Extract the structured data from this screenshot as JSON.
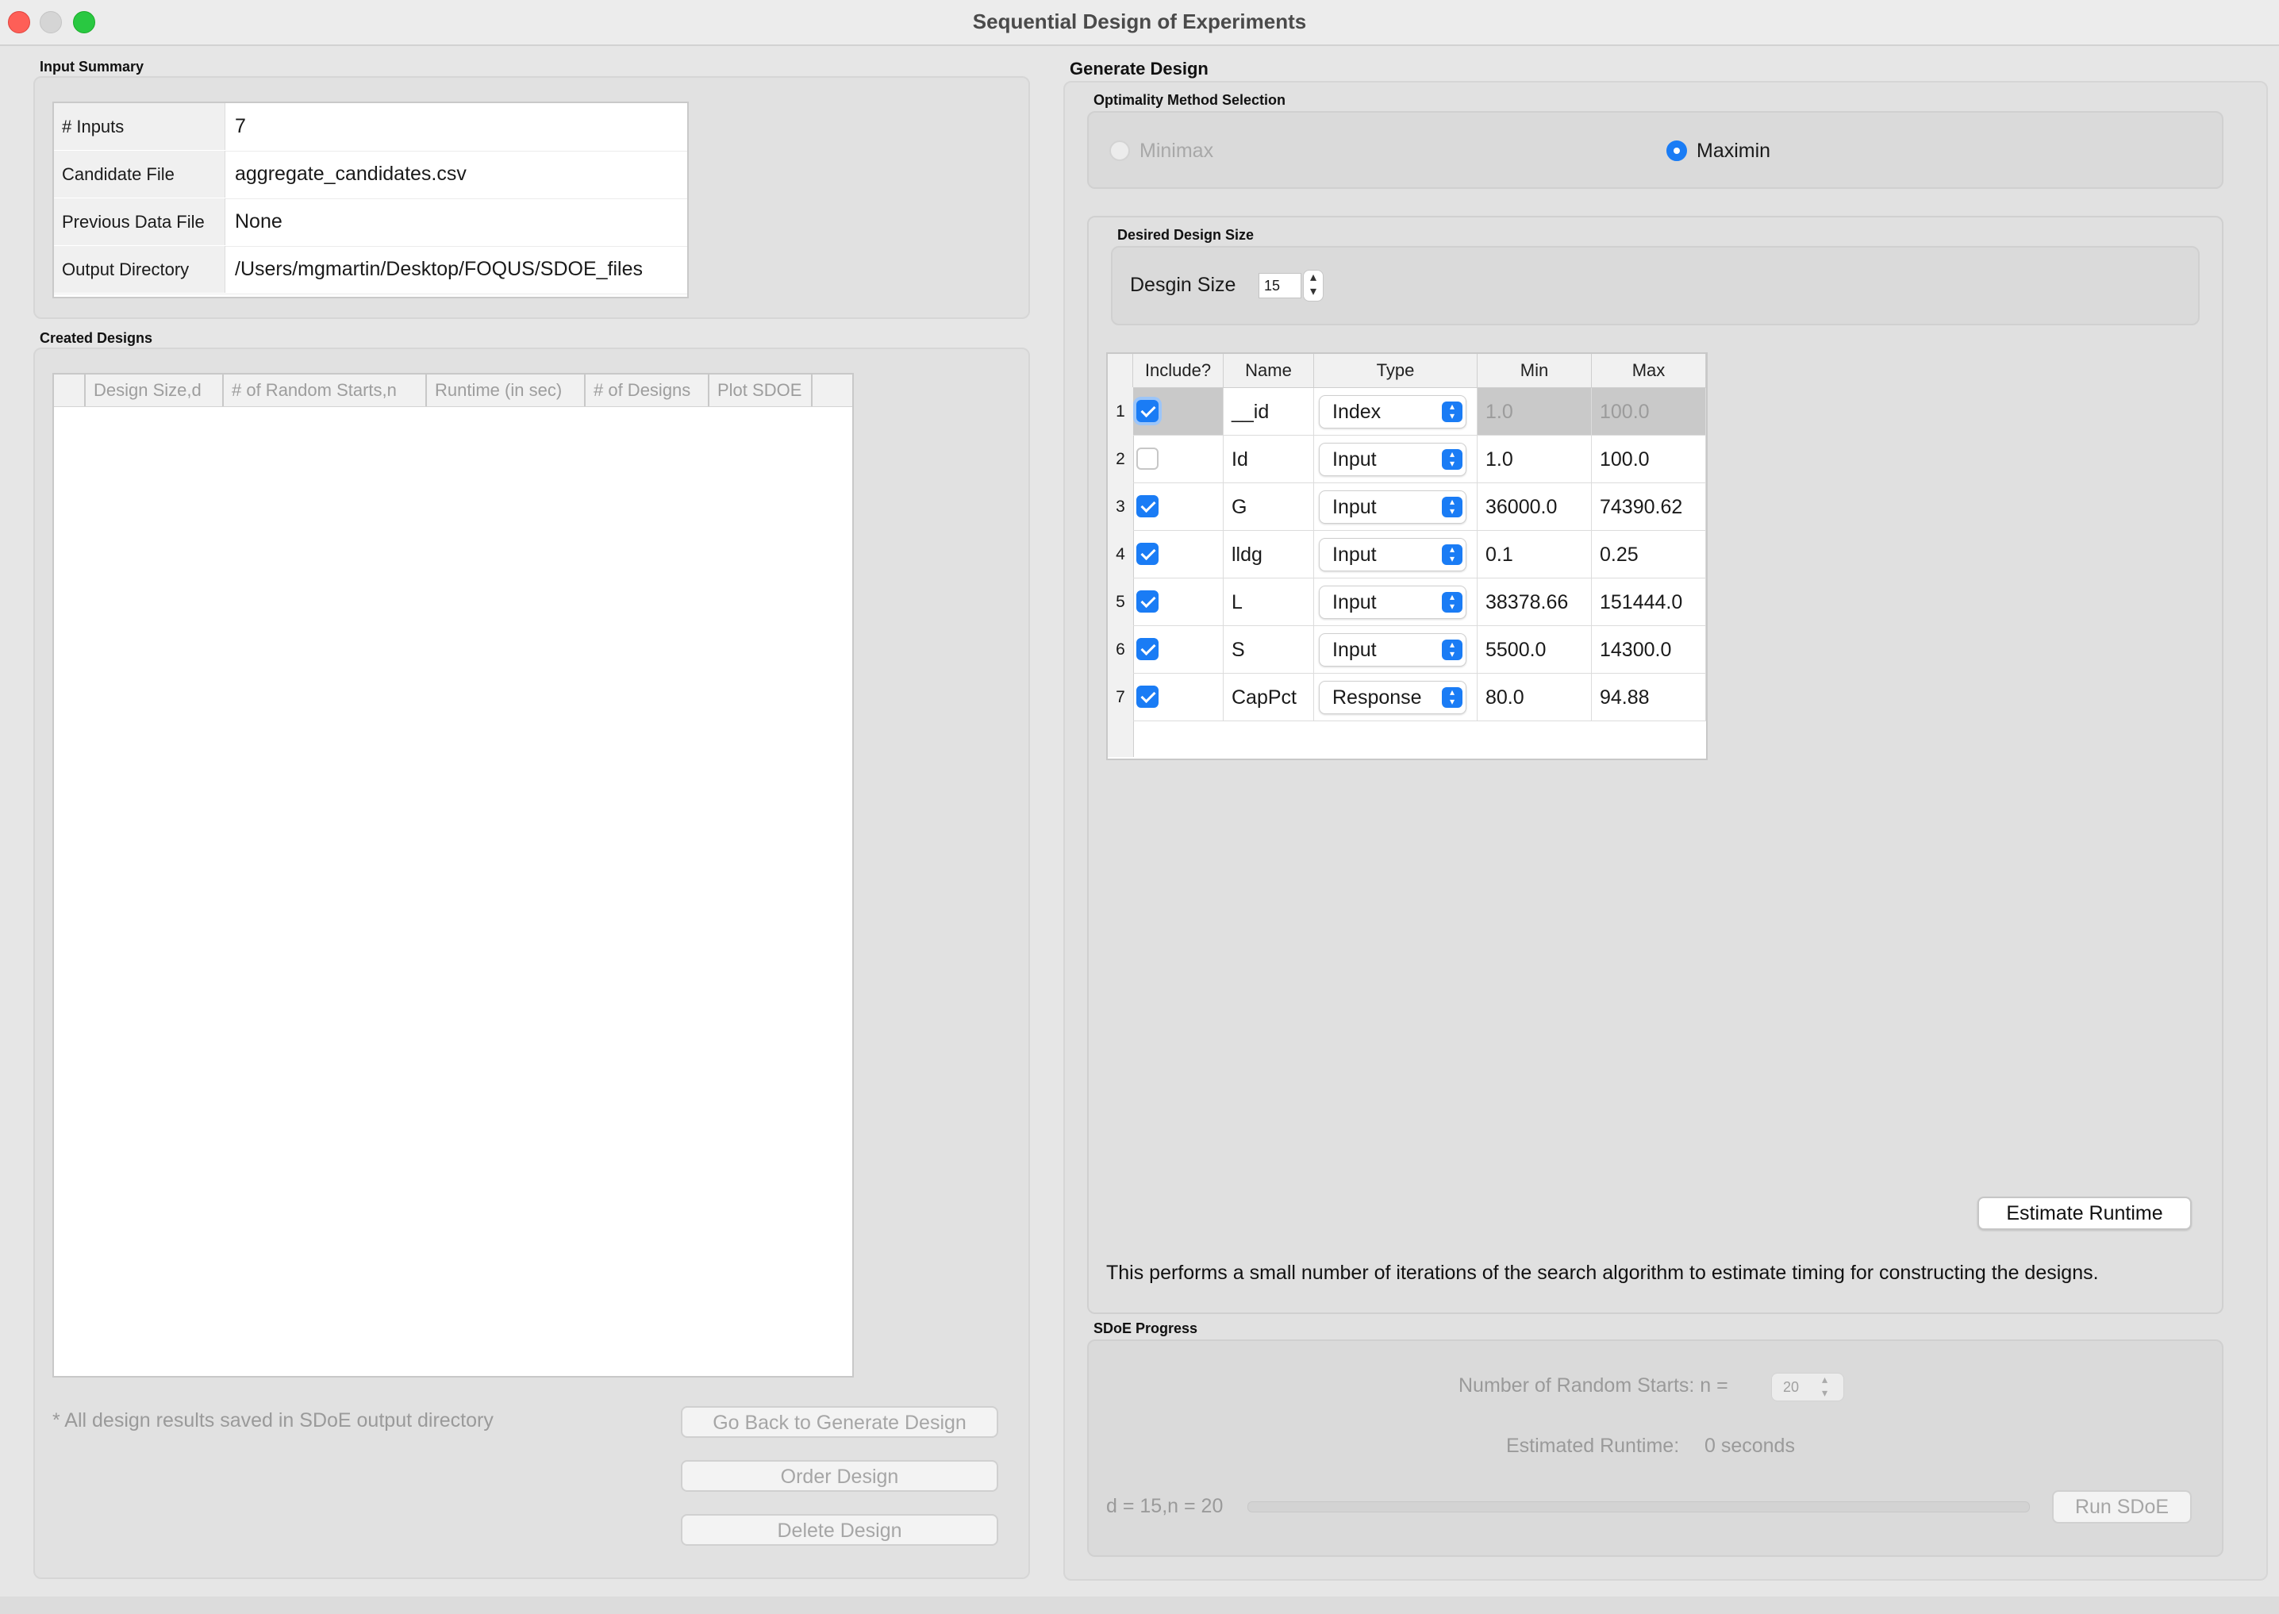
{
  "window": {
    "title": "Sequential Design of Experiments"
  },
  "input_summary": {
    "label": "Input Summary",
    "rows": [
      {
        "key": "# Inputs",
        "value": "7"
      },
      {
        "key": "Candidate File",
        "value": "aggregate_candidates.csv"
      },
      {
        "key": "Previous Data File",
        "value": "None"
      },
      {
        "key": "Output Directory",
        "value": "/Users/mgmartin/Desktop/FOQUS/SDOE_files"
      }
    ]
  },
  "created_designs": {
    "label": "Created Designs",
    "columns": [
      "",
      "Design Size,d",
      "# of Random Starts,n",
      "Runtime (in sec)",
      "# of Designs",
      "Plot SDOE"
    ],
    "note": "* All design results saved in SDoE output directory",
    "buttons": {
      "go_back": "Go Back to Generate Design",
      "order": "Order Design",
      "delete": "Delete Design"
    }
  },
  "generate_design": {
    "label": "Generate Design",
    "optimality": {
      "label": "Optimality Method Selection",
      "options": [
        {
          "label": "Minimax",
          "selected": false,
          "enabled": false
        },
        {
          "label": "Maximin",
          "selected": true,
          "enabled": true
        }
      ]
    },
    "design_size": {
      "label": "Desired Design Size",
      "field_label": "Desgin Size",
      "value": "15"
    },
    "table": {
      "columns": [
        "Include?",
        "Name",
        "Type",
        "Min",
        "Max"
      ],
      "rows": [
        {
          "num": "1",
          "include": true,
          "name": "__id",
          "type": "Index",
          "min": "1.0",
          "max": "100.0"
        },
        {
          "num": "2",
          "include": false,
          "name": "Id",
          "type": "Input",
          "min": "1.0",
          "max": "100.0"
        },
        {
          "num": "3",
          "include": true,
          "name": "G",
          "type": "Input",
          "min": "36000.0",
          "max": "74390.62"
        },
        {
          "num": "4",
          "include": true,
          "name": "lldg",
          "type": "Input",
          "min": "0.1",
          "max": "0.25"
        },
        {
          "num": "5",
          "include": true,
          "name": "L",
          "type": "Input",
          "min": "38378.66",
          "max": "151444.0"
        },
        {
          "num": "6",
          "include": true,
          "name": "S",
          "type": "Input",
          "min": "5500.0",
          "max": "14300.0"
        },
        {
          "num": "7",
          "include": true,
          "name": "CapPct",
          "type": "Response",
          "min": "80.0",
          "max": "94.88"
        }
      ]
    },
    "estimate_button": "Estimate Runtime",
    "description": "This performs a small number of iterations of the search algorithm to estimate timing for constructing the designs."
  },
  "sdoe_progress": {
    "label": "SDoE Progress",
    "random_starts_label": "Number of Random Starts: n =",
    "random_starts_value": "20",
    "runtime_label": "Estimated Runtime:",
    "runtime_value": "0 seconds",
    "status": "d = 15,n = 20",
    "progress": 0,
    "run_button": "Run SDoE"
  },
  "colors": {
    "accent": "#1a7cf5",
    "close": "#fe5f57",
    "maximize": "#29c841"
  }
}
